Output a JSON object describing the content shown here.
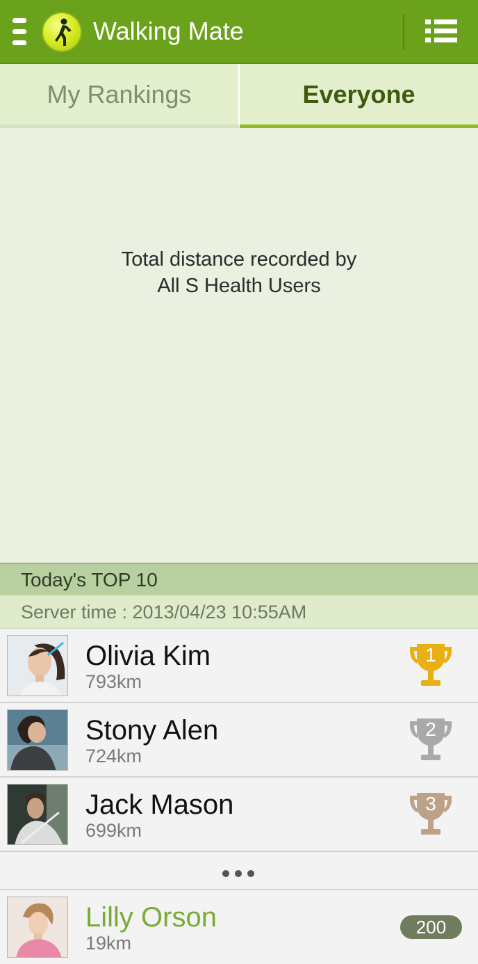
{
  "app": {
    "title": "Walking Mate",
    "logo_icon": "walking-person-icon",
    "brand_color": "#6ba21b"
  },
  "tabs": [
    {
      "label": "My Rankings",
      "selected": false
    },
    {
      "label": "Everyone",
      "selected": true
    }
  ],
  "main": {
    "total_line1": "Total distance recorded by",
    "total_line2": "All S Health Users"
  },
  "top10": {
    "header": "Today's TOP 10",
    "server_time": "Server time : 2013/04/23 10:55AM"
  },
  "rankings": [
    {
      "rank": "1",
      "name": "Olivia Kim",
      "distance": "793km",
      "trophy": "gold",
      "trophy_color": "#e8b012"
    },
    {
      "rank": "2",
      "name": "Stony Alen",
      "distance": "724km",
      "trophy": "silver",
      "trophy_color": "#a9a9a9"
    },
    {
      "rank": "3",
      "name": "Jack Mason",
      "distance": "699km",
      "trophy": "bronze",
      "trophy_color": "#bba288"
    }
  ],
  "me": {
    "name": "Lilly Orson",
    "distance": "19km",
    "rank": "200",
    "name_color": "#79ac34"
  }
}
